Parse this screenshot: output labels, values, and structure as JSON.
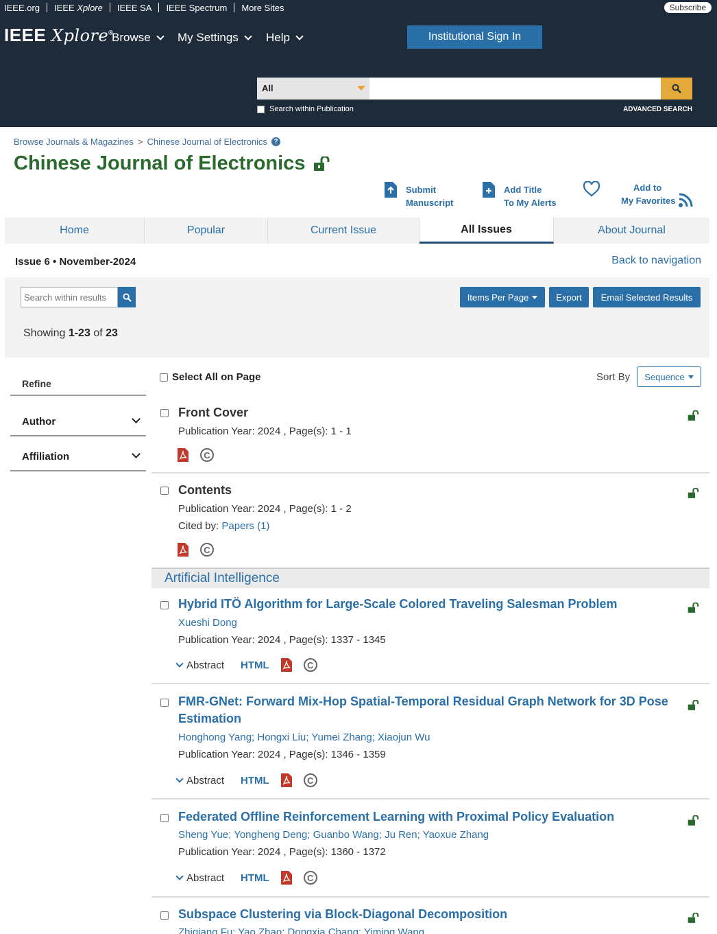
{
  "topbar": {
    "links": [
      "IEEE.org",
      "IEEE Xplore",
      "IEEE SA",
      "IEEE Spectrum",
      "More Sites"
    ],
    "subscribe": "Subscribe"
  },
  "header": {
    "logo_ieee": "IEEE",
    "logo_xplore": "Xplore",
    "nav": [
      "Browse",
      "My Settings",
      "Help"
    ],
    "sign_in": "Institutional Sign In",
    "search_scope": "All",
    "search_within": "Search within Publication",
    "advanced": "ADVANCED SEARCH",
    "accent": "#e4a93b"
  },
  "breadcrumb": [
    "Browse Journals & Magazines",
    "Chinese Journal of Electronics"
  ],
  "publication": {
    "title": "Chinese Journal of Electronics",
    "actions": {
      "submit": [
        "Submit",
        "Manuscript"
      ],
      "alerts": [
        "Add Title",
        "To My Alerts"
      ],
      "favorites": [
        "Add to",
        "My Favorites"
      ]
    }
  },
  "tabs": [
    "Home",
    "Popular",
    "Current Issue",
    "All Issues",
    "About Journal"
  ],
  "issue": {
    "label": "Issue 6 • November-2024",
    "back": "Back to navigation"
  },
  "toolbar": {
    "search_placeholder": "Search within results",
    "items_per_page": "Items Per Page",
    "export": "Export",
    "email": "Email Selected Results",
    "showing_prefix": "Showing",
    "showing_range": "1-23",
    "showing_of": "of",
    "showing_total": "23"
  },
  "sidebar": {
    "refine": "Refine",
    "facets": [
      "Author",
      "Affiliation"
    ]
  },
  "results_header": {
    "select_all": "Select All on Page",
    "sort_by": "Sort By",
    "sort_value": "Sequence"
  },
  "section": "Artificial Intelligence",
  "results": [
    {
      "title": "Front Cover",
      "meta": "Publication Year: 2024 , Page(s): 1  -  1"
    },
    {
      "title": "Contents",
      "meta": "Publication Year: 2024 , Page(s): 1  -  2",
      "cited_prefix": "Cited by: ",
      "cited_link": "Papers (1)"
    },
    {
      "title": "Hybrid ITÖ Algorithm for Large-Scale Colored Traveling Salesman Problem",
      "authors": "Xueshi Dong",
      "meta": "Publication Year: 2024 , Page(s): 1337  -  1345"
    },
    {
      "title": "FMR-GNet: Forward Mix-Hop Spatial-Temporal Residual Graph Network for 3D Pose Estimation",
      "authors": "Honghong Yang; Hongxi Liu; Yumei Zhang; Xiaojun Wu",
      "meta": "Publication Year: 2024 , Page(s): 1346  -  1359"
    },
    {
      "title": "Federated Offline Reinforcement Learning with Proximal Policy Evaluation",
      "authors": "Sheng Yue; Yongheng Deng; Guanbo Wang; Ju Ren; Yaoxue Zhang",
      "meta": "Publication Year: 2024 , Page(s): 1360  -  1372"
    },
    {
      "title": "Subspace Clustering via Block-Diagonal Decomposition",
      "authors": "Zhiqiang Fu; Yao Zhao; Dongxia Chang; Yiming Wang"
    }
  ],
  "labels": {
    "abstract": "Abstract",
    "html": "HTML"
  }
}
